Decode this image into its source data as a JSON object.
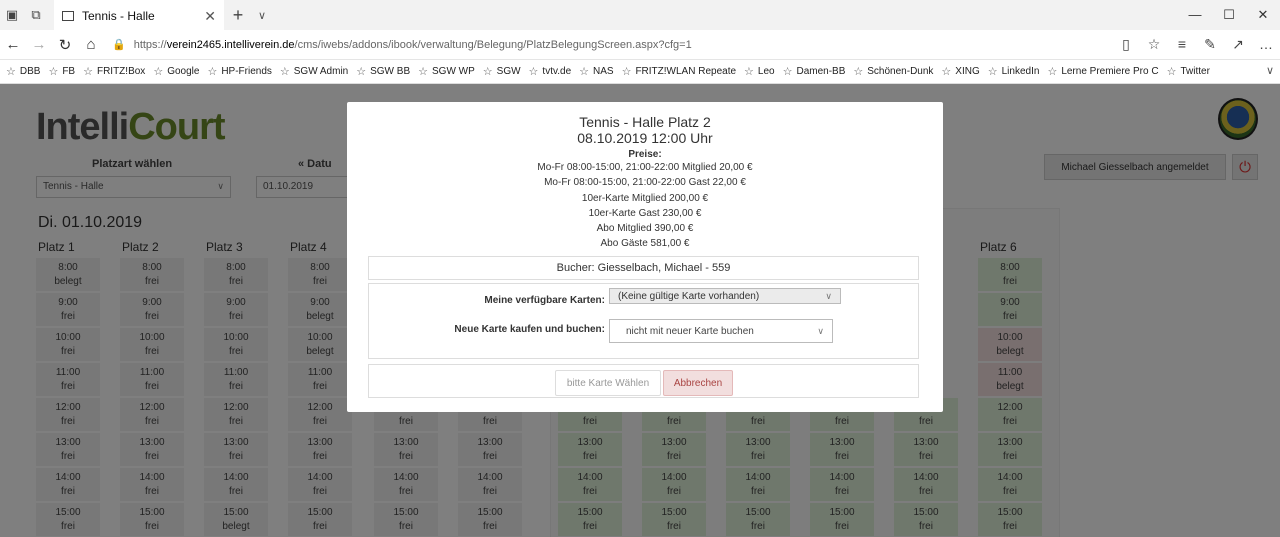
{
  "browser": {
    "tab_title": "Tennis - Halle",
    "url_prefix": "https://",
    "url_host": "verein2465.intelliverein.de",
    "url_path": "/cms/iwebs/addons/ibook/verwaltung/Belegung/PlatzBelegungScreen.aspx?cfg=1",
    "favorites": [
      "DBB",
      "FB",
      "FRITZ!Box",
      "Google",
      "HP-Friends",
      "SGW Admin",
      "SGW BB",
      "SGW WP",
      "SGW",
      "tvtv.de",
      "NAS",
      "FRITZ!WLAN Repeate",
      "Leo",
      "Damen-BB",
      "Schönen-Dunk",
      "XING",
      "LinkedIn",
      "Lerne Premiere Pro C",
      "Twitter"
    ]
  },
  "app": {
    "logo_prefix": "Intelli",
    "logo_suffix": "Court",
    "court_type_label": "Platzart wählen",
    "court_type_value": "Tennis - Halle",
    "date_label": "« Datu",
    "date_value": "01.10.2019",
    "user_button": "Michael Giesselbach angemeldet",
    "day_heading": "Di. 01.10.2019"
  },
  "grid": {
    "columns": [
      "Platz 1",
      "Platz 2",
      "Platz 3",
      "Platz 4",
      "Platz 6"
    ],
    "times": [
      "8:00",
      "9:00",
      "10:00",
      "11:00",
      "12:00",
      "13:00",
      "14:00",
      "15:00"
    ],
    "free": "frei",
    "booked": "belegt"
  },
  "modal": {
    "court": "Tennis - Halle Platz 2",
    "datetime": "08.10.2019 12:00 Uhr",
    "prices_label": "Preise:",
    "prices": [
      "Mo-Fr 08:00-15:00, 21:00-22:00 Mitglied 20,00 €",
      "Mo-Fr 08:00-15:00, 21:00-22:00 Gast 22,00 €",
      "10er-Karte Mitglied 200,00 €",
      "10er-Karte Gast 230,00 €",
      "Abo Mitglied 390,00 €",
      "Abo Gäste 581,00 €"
    ],
    "booker": "Bucher: Giesselbach, Michael - 559",
    "my_cards_label": "Meine verfügbare Karten:",
    "my_cards_value": "(Keine gültige Karte vorhanden)",
    "new_card_label": "Neue Karte kaufen und buchen:",
    "new_card_value": "nicht mit neuer Karte buchen",
    "choose_button": "bitte Karte Wählen",
    "cancel_button": "Abbrechen"
  }
}
